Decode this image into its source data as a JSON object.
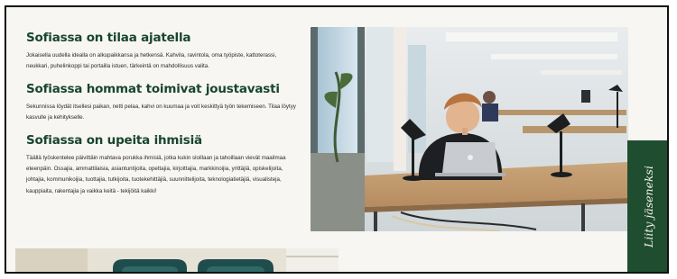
{
  "sections": [
    {
      "heading": "Sofiassa on tilaa ajatella",
      "body": "Jokaisella uudella idealla on alkupaikkansa ja hetkensä. Kahvila, ravintola, oma työpiste, kattoterassi, neukkari, puhelinkoppi tai portailla istuen, tärkeintä on mahdollisuus valita."
    },
    {
      "heading": "Sofiassa hommat toimivat joustavasti",
      "body": "Sekunnissa löydät itsellesi paikan, netti pelaa, kahvi on kuumaa ja voit keskittyä työn tekemiseen. Tilaa löytyy kasvulle ja kehitykselle."
    },
    {
      "heading": "Sofiassa on upeita ihmisiä",
      "body": "Täällä työskentelee päivittäin mahtava porukka ihmisiä, jotka kukin sloillaan ja tahoillaan vievät maailmaa eteenpäin. Ossajia, ammattilaisia, asiantuntijoita, opettajia, kirjoittajia, markkinoijia, yrittäjiä, opiskelijoita, johtajia, kommunikoijia, tuottajia, tutkijoita, tuotekehittäjiä, suunnittelijoita, teknologiatietäjiä, visualisteja, kauppiaita, rakentajia ja vaikka keitä - tekijöitä kaikki!"
    }
  ],
  "cta": {
    "label": "Liity jäseneksi"
  },
  "colors": {
    "heading": "#19452f",
    "cta_bg": "#1f4d2f",
    "page_bg": "#f7f6f2"
  }
}
